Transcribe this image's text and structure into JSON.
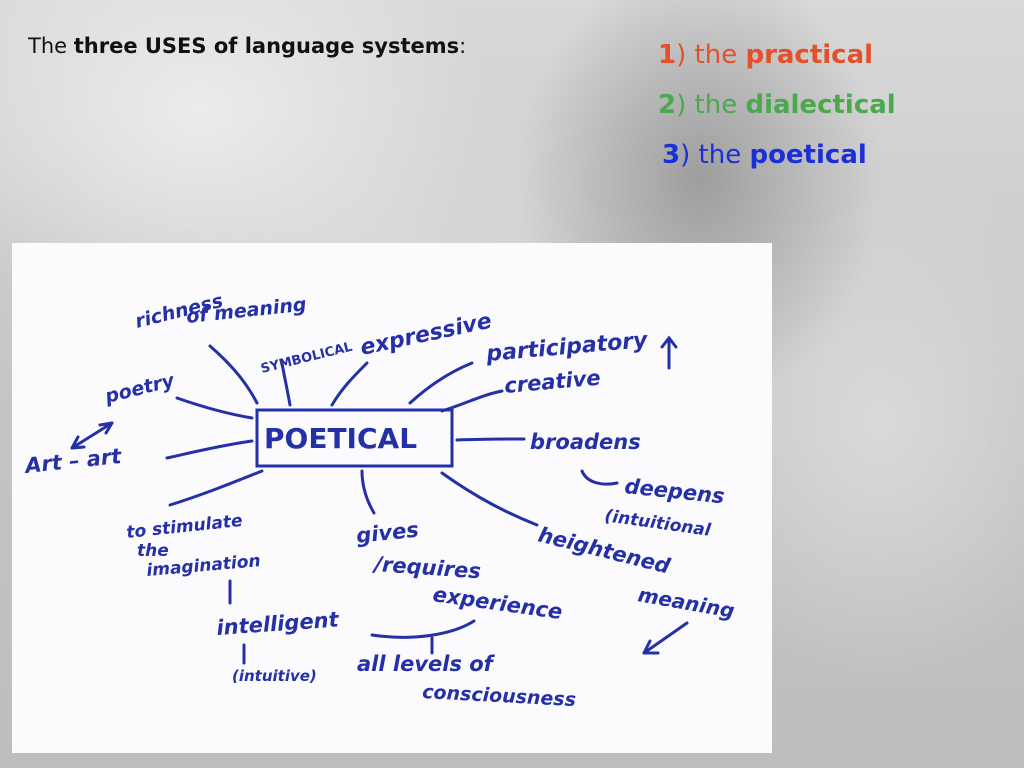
{
  "slide": {
    "title_prefix": "The ",
    "title_bold": "three USES of language systems",
    "title_suffix": ":"
  },
  "uses": [
    {
      "number": "1",
      "paren": ")",
      "article": " the ",
      "name": "practical",
      "color": "#e3502a"
    },
    {
      "number": "2",
      "paren": ")",
      "article": " the ",
      "name": "dialectical",
      "color": "#4ba84f"
    },
    {
      "number": "3",
      "paren": ")",
      "article": " the ",
      "name": "poetical",
      "color": "#1a2fd6"
    }
  ],
  "sketch": {
    "center": "POETICAL",
    "nodes": {
      "richness_1": "richness",
      "richness_2": "of meaning",
      "symbolical": "SYMBOLICAL",
      "expressive": "expressive",
      "participatory": "participatory",
      "creative": "creative",
      "poetry": "poetry",
      "art": "Art – art",
      "broadens": "broadens",
      "deepens": "deepens",
      "intuitional": "(intuitional",
      "heightened_1": "heightened",
      "heightened_2": "meaning",
      "stimulate_1": "to stimulate",
      "stimulate_2": "the",
      "stimulate_3": "imagination",
      "gives_1": "gives",
      "gives_2": "/requires",
      "experience": "experience",
      "intelligent": "intelligent",
      "intuitive": "(intuitive)",
      "levels_1": "all levels of",
      "levels_2": "consciousness"
    },
    "ink_color": "#2530a6"
  }
}
